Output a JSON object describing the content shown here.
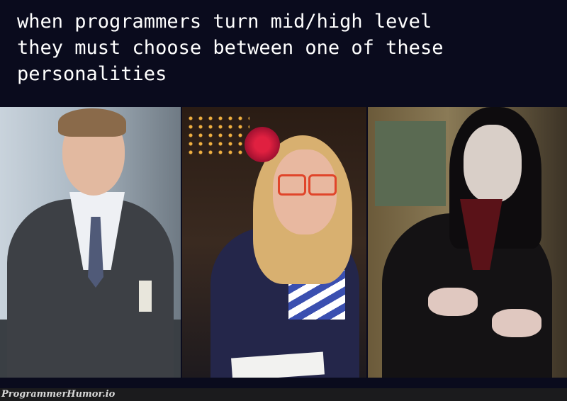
{
  "caption": "when programmers turn mid/high level\nthey must choose between one of these\npersonalities",
  "panels": [
    {
      "name": "businessman-in-suit"
    },
    {
      "name": "quirky-woman-with-glasses"
    },
    {
      "name": "gothic-vampire-man"
    }
  ],
  "watermark": "ProgrammerHumor.io",
  "colors": {
    "background": "#0a0b1d",
    "caption_text": "#ffffff",
    "footer": "#1b1b1d"
  }
}
